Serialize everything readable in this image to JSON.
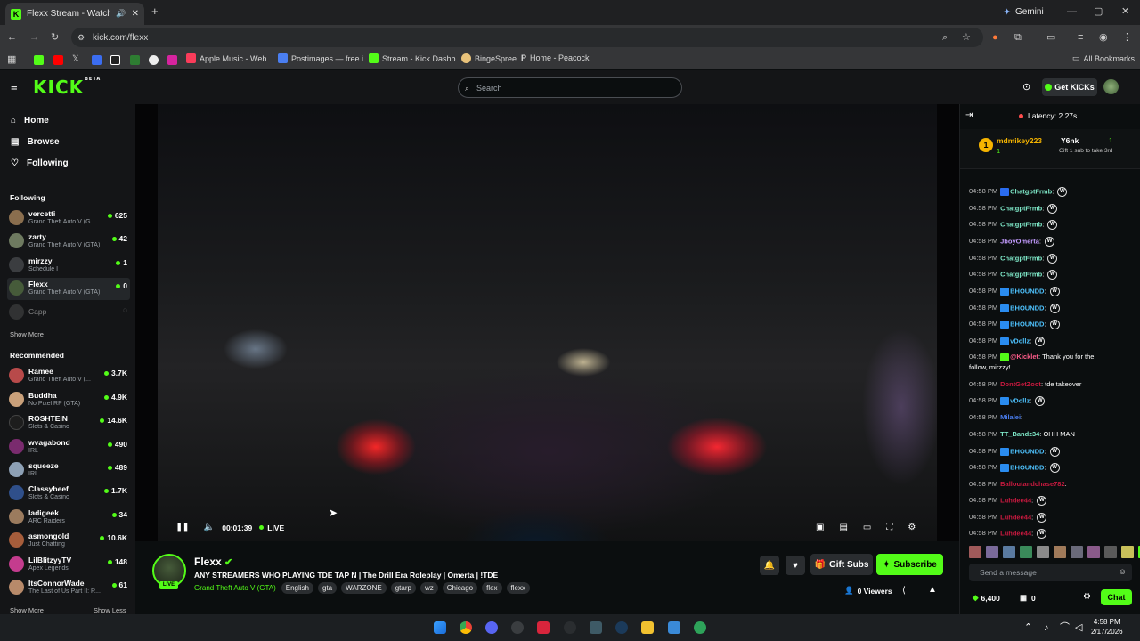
{
  "browser": {
    "tab_title": "Flexx Stream - Watch Live o",
    "gemini_label": "Gemini",
    "url": "kick.com/flexx",
    "bookmarks": [
      "Apple Music - Web...",
      "Postimages — free i...",
      "Stream - Kick Dashb...",
      "BingeSpree",
      "Home - Peacock"
    ],
    "all_bookmarks": "All Bookmarks"
  },
  "header": {
    "logo": "KICK",
    "logo_badge": "BETA",
    "search_placeholder": "Search",
    "get_kicks": "Get KICKs"
  },
  "sidebar": {
    "nav": [
      "Home",
      "Browse",
      "Following"
    ],
    "following_heading": "Following",
    "following": [
      {
        "name": "vercetti",
        "game": "Grand Theft Auto V (G...",
        "viewers": "625",
        "live": true
      },
      {
        "name": "zarty",
        "game": "Grand Theft Auto V (GTA)",
        "viewers": "42",
        "live": true
      },
      {
        "name": "mirzzy",
        "game": "Schedule I",
        "viewers": "1",
        "live": true
      },
      {
        "name": "Flexx",
        "game": "Grand Theft Auto V (GTA)",
        "viewers": "0",
        "live": true
      },
      {
        "name": "Capp",
        "game": "",
        "viewers": "",
        "live": false
      }
    ],
    "show_more": "Show More",
    "recommended_heading": "Recommended",
    "recommended": [
      {
        "name": "Ramee",
        "game": "Grand Theft Auto V (...",
        "viewers": "3.7K"
      },
      {
        "name": "Buddha",
        "game": "No Pixel RP (GTA)",
        "viewers": "4.9K"
      },
      {
        "name": "ROSHTEIN",
        "game": "Slots & Casino",
        "viewers": "14.6K"
      },
      {
        "name": "wvagabond",
        "game": "IRL",
        "viewers": "490"
      },
      {
        "name": "squeeze",
        "game": "IRL",
        "viewers": "489"
      },
      {
        "name": "Classybeef",
        "game": "Slots & Casino",
        "viewers": "1.7K"
      },
      {
        "name": "ladigeek",
        "game": "ARC Raiders",
        "viewers": "34"
      },
      {
        "name": "asmongold",
        "game": "Just Chatting",
        "viewers": "10.6K"
      },
      {
        "name": "LilBlitzyyTV",
        "game": "Apex Legends",
        "viewers": "148"
      },
      {
        "name": "ItsConnorWade",
        "game": "The Last of Us Part II: R...",
        "viewers": "61"
      }
    ],
    "show_more_2": "Show More",
    "show_less": "Show Less"
  },
  "player": {
    "time": "00:01:39",
    "live_label": "LIVE"
  },
  "channel": {
    "name": "Flexx",
    "live_badge": "LIVE",
    "title": "ANY STREAMERS WHO PLAYING TDE TAP N | The Drill Era Roleplay | Omerta | !TDE",
    "category": "Grand Theft Auto V (GTA)",
    "tags": [
      "English",
      "gta",
      "WARZONE",
      "gtarp",
      "wz",
      "Chicago",
      "flex",
      "flexx"
    ],
    "gift_subs": "Gift Subs",
    "subscribe": "Subscribe",
    "viewers": "0 Viewers"
  },
  "chat": {
    "latency": "Latency: 2.27s",
    "pinned": {
      "rank": "1",
      "user1": "mdmikey223",
      "user1_count": "1",
      "user2": "Y6nk",
      "user2_count": "1",
      "gift_note": "Gift 1 sub to take 3rd"
    },
    "messages": [
      {
        "time": "04:58 PM",
        "user": "ChatgptFrmb",
        "color": "#7ee8c8",
        "text": "",
        "emote": true,
        "badge": "#2a6cf0"
      },
      {
        "time": "04:58 PM",
        "user": "ChatgptFrmb",
        "color": "#7ee8c8",
        "text": "",
        "emote": true,
        "badge": ""
      },
      {
        "time": "04:58 PM",
        "user": "ChatgptFrmb",
        "color": "#7ee8c8",
        "text": "",
        "emote": true,
        "badge": ""
      },
      {
        "time": "04:58 PM",
        "user": "JboyOmerta",
        "color": "#c39bff",
        "text": "",
        "emote": true,
        "badge": ""
      },
      {
        "time": "04:58 PM",
        "user": "ChatgptFrmb",
        "color": "#7ee8c8",
        "text": "",
        "emote": true,
        "badge": ""
      },
      {
        "time": "04:58 PM",
        "user": "ChatgptFrmb",
        "color": "#7ee8c8",
        "text": "",
        "emote": true,
        "badge": ""
      },
      {
        "time": "04:58 PM",
        "user": "BHOUNDD",
        "color": "#4ec3ff",
        "text": "",
        "emote": true,
        "badge": "#2a8cf0"
      },
      {
        "time": "04:58 PM",
        "user": "BHOUNDD",
        "color": "#4ec3ff",
        "text": "",
        "emote": true,
        "badge": "#2a8cf0"
      },
      {
        "time": "04:58 PM",
        "user": "BHOUNDD",
        "color": "#4ec3ff",
        "text": "",
        "emote": true,
        "badge": "#2a8cf0"
      },
      {
        "time": "04:58 PM",
        "user": "vDollz",
        "color": "#4ec3ff",
        "text": "",
        "emote": true,
        "badge": "#2a8cf0"
      },
      {
        "time": "04:58 PM",
        "user": "@Kicklet",
        "color": "#ff5c8a",
        "text": "Thank you for the",
        "emote": false,
        "badge": "#53fc18"
      },
      {
        "time": "",
        "user": "",
        "color": "#fff",
        "text": "follow, mirzzy!",
        "emote": false,
        "badge": ""
      },
      {
        "time": "04:58 PM",
        "user": "DontGetZoot",
        "color": "#c9193f",
        "text": "tde takeover",
        "emote": false,
        "badge": ""
      },
      {
        "time": "04:58 PM",
        "user": "vDollz",
        "color": "#4ec3ff",
        "text": "",
        "emote": true,
        "badge": "#2a8cf0"
      },
      {
        "time": "04:58 PM",
        "user": "Milalei",
        "color": "#4a7ef0",
        "text": "",
        "emote": false,
        "badge": ""
      },
      {
        "time": "04:58 PM",
        "user": "TT_Bandz34",
        "color": "#7ee8c8",
        "text": "OHH MAN",
        "emote": false,
        "badge": ""
      },
      {
        "time": "04:58 PM",
        "user": "BHOUNDD",
        "color": "#4ec3ff",
        "text": "",
        "emote": true,
        "badge": "#2a8cf0"
      },
      {
        "time": "04:58 PM",
        "user": "BHOUNDD",
        "color": "#4ec3ff",
        "text": "",
        "emote": true,
        "badge": "#2a8cf0"
      },
      {
        "time": "04:58 PM",
        "user": "Balloutandchase782",
        "color": "#c9193f",
        "text": "",
        "emote": false,
        "badge": ""
      },
      {
        "time": "04:58 PM",
        "user": "Luhdee44",
        "color": "#c9193f",
        "text": "",
        "emote": true,
        "badge": ""
      },
      {
        "time": "04:58 PM",
        "user": "Luhdee44",
        "color": "#c9193f",
        "text": "",
        "emote": true,
        "badge": ""
      },
      {
        "time": "04:58 PM",
        "user": "Luhdee44",
        "color": "#c9193f",
        "text": "",
        "emote": true,
        "badge": ""
      }
    ],
    "input_placeholder": "Send a message",
    "kicks_balance": "6,400",
    "points": "0",
    "chat_button": "Chat"
  },
  "taskbar": {
    "time": "4:58 PM",
    "date": "2/17/2026"
  },
  "colors": {
    "brand": "#53fc18",
    "background": "#0b0e0f",
    "panel": "#141517"
  }
}
